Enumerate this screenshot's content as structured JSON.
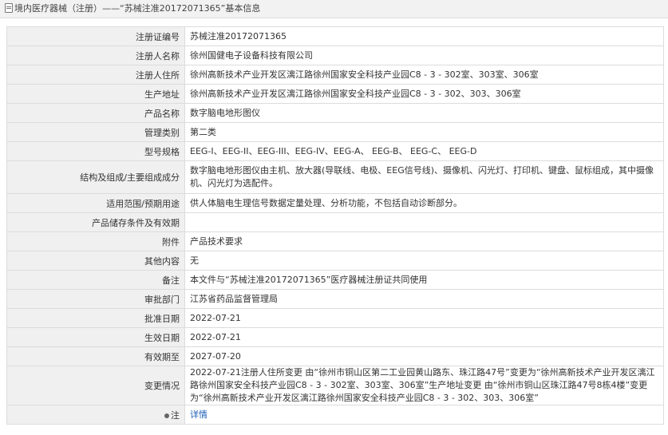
{
  "header": {
    "title": "境内医疗器械（注册）——“苏械注准20172071365”基本信息"
  },
  "rows": [
    {
      "label": "注册证编号",
      "value": "苏械注准20172071365"
    },
    {
      "label": "注册人名称",
      "value": "徐州国健电子设备科技有限公司"
    },
    {
      "label": "注册人住所",
      "value": "徐州高新技术产业开发区漓江路徐州国家安全科技产业园C8 - 3 - 302室、303室、306室"
    },
    {
      "label": "生产地址",
      "value": "徐州高新技术产业开发区漓江路徐州国家安全科技产业园C8 - 3 - 302、303、306室"
    },
    {
      "label": "产品名称",
      "value": "数字脑电地形图仪"
    },
    {
      "label": "管理类别",
      "value": "第二类"
    },
    {
      "label": "型号规格",
      "value": "EEG-I、EEG-II、EEG-III、EEG-IV、EEG-A、 EEG-B、 EEG-C、 EEG-D"
    },
    {
      "label": "结构及组成/主要组成成分",
      "value": "数字脑电地形图仪由主机、放大器(导联线、电极、EEG信号线)、摄像机、闪光灯、打印机、键盘、鼠标组成，其中摄像机、闪光灯为选配件。"
    },
    {
      "label": "适用范围/预期用途",
      "value": "供人体脑电生理信号数据定量处理、分析功能，不包括自动诊断部分。"
    },
    {
      "label": "产品储存条件及有效期",
      "value": ""
    },
    {
      "label": "附件",
      "value": "产品技术要求"
    },
    {
      "label": "其他内容",
      "value": "无"
    },
    {
      "label": "备注",
      "value": "本文件与“苏械注准20172071365”医疗器械注册证共同使用"
    },
    {
      "label": "审批部门",
      "value": "江苏省药品监督管理局"
    },
    {
      "label": "批准日期",
      "value": "2022-07-21"
    },
    {
      "label": "生效日期",
      "value": "2022-07-21"
    },
    {
      "label": "有效期至",
      "value": "2027-07-20"
    },
    {
      "label": "变更情况",
      "value": "2022-07-21注册人住所变更 由“徐州市铜山区第二工业园黄山路东、珠江路47号”变更为“徐州高新技术产业开发区漓江路徐州国家安全科技产业园C8 - 3 - 302室、303室、306室”生产地址变更 由“徐州市铜山区珠江路47号8栋4楼”变更为“徐州高新技术产业开发区漓江路徐州国家安全科技产业园C8 - 3 - 302、303、306室”"
    }
  ],
  "footer_row": {
    "label": "注",
    "icon": "pin-icon",
    "link_text": "详情"
  }
}
